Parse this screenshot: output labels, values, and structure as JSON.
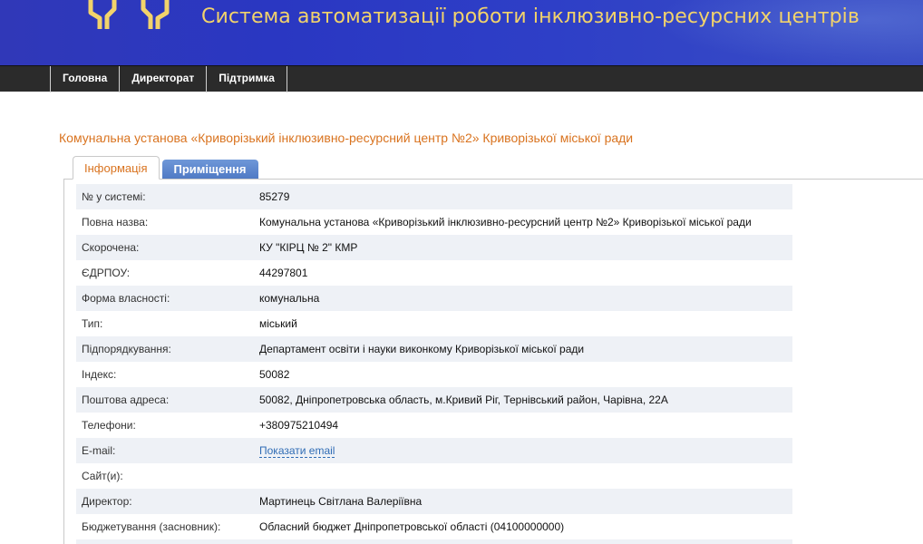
{
  "header": {
    "title": "Система автоматизації роботи інклюзивно-ресурсних центрів",
    "logo_icon": "pillars-logo-icon",
    "accent_color": "#f2d36b",
    "background_color": "#2e3cc4"
  },
  "nav": {
    "items": [
      {
        "label": "Головна"
      },
      {
        "label": "Директорат"
      },
      {
        "label": "Підтримка"
      }
    ]
  },
  "page": {
    "org_title": "Комунальна установа «Криворізький інклюзивно-ресурсний центр №2» Криворізької міської ради",
    "tabs": [
      {
        "label": "Інформація",
        "active": true
      },
      {
        "label": "Приміщення",
        "active": false
      }
    ]
  },
  "info": {
    "rows": [
      {
        "key": "№ у системі:",
        "value": "85279"
      },
      {
        "key": "Повна назва:",
        "value": "Комунальна установа «Криворізький інклюзивно-ресурсний центр №2» Криворізької міської ради"
      },
      {
        "key": "Скорочена:",
        "value": "КУ \"КІРЦ № 2\" КМР"
      },
      {
        "key": "ЄДРПОУ:",
        "value": "44297801"
      },
      {
        "key": "Форма власності:",
        "value": "комунальна"
      },
      {
        "key": "Тип:",
        "value": "міський"
      },
      {
        "key": "Підпорядкування:",
        "value": "Департамент освіти і науки виконкому Криворізької міської ради"
      },
      {
        "key": "Індекс:",
        "value": "50082"
      },
      {
        "key": "Поштова адреса:",
        "value": "50082, Дніпропетровська область, м.Кривий Ріг, Тернівський район, Чарівна, 22А"
      },
      {
        "key": "Телефони:",
        "value": "+380975210494"
      },
      {
        "key": "E-mail:",
        "value": "Показати email"
      },
      {
        "key": "Сайт(и):",
        "value": ""
      },
      {
        "key": "Директор:",
        "value": "Мартинець Світлана Валеріївна"
      },
      {
        "key": "Бюджетування (засновник):",
        "value": "Обласний бюджет Дніпропетровської області (04100000000)"
      }
    ]
  }
}
